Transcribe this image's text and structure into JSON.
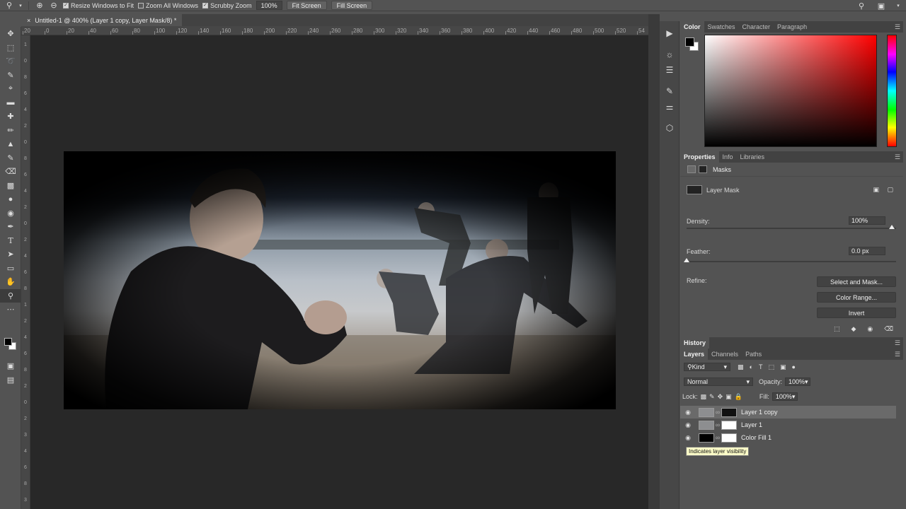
{
  "options_bar": {
    "resize_windows": "Resize Windows to Fit",
    "zoom_all": "Zoom All Windows",
    "scrubby": "Scrubby Zoom",
    "zoom_value": "100%",
    "fit_screen": "Fit Screen",
    "fill_screen": "Fill Screen"
  },
  "document": {
    "tab_title": "Untitled-1 @ 400% (Layer 1 copy, Layer Mask/8) *",
    "close": "×"
  },
  "rulers": {
    "top_labels": [
      "20",
      "0",
      "20",
      "40",
      "60",
      "80",
      "100",
      "120",
      "140",
      "160",
      "180",
      "200",
      "220",
      "240",
      "260",
      "280",
      "300",
      "320",
      "340",
      "360",
      "380",
      "400",
      "420",
      "440",
      "460",
      "480",
      "500",
      "520",
      "54"
    ],
    "left_labels": [
      "1",
      "0",
      "8",
      "6",
      "4",
      "2",
      "0",
      "8",
      "6",
      "4",
      "2",
      "0",
      "2",
      "4",
      "6",
      "8",
      "1",
      "2",
      "4",
      "6",
      "8",
      "2",
      "0",
      "2",
      "3",
      "4",
      "6",
      "8",
      "3"
    ]
  },
  "color_panel": {
    "tabs": [
      "Color",
      "Swatches",
      "Character",
      "Paragraph"
    ],
    "active_tab": "Color"
  },
  "properties_panel": {
    "tabs": [
      "Properties",
      "Info",
      "Libraries"
    ],
    "header": "Masks",
    "mask_label": "Layer Mask",
    "density_label": "Density:",
    "density_value": "100%",
    "density": 1.0,
    "feather_label": "Feather:",
    "feather_value": "0.0 px",
    "feather": 0.0,
    "refine_label": "Refine:",
    "select_and_mask": "Select and Mask...",
    "color_range": "Color Range...",
    "invert": "Invert"
  },
  "history_panel": {
    "tab": "History"
  },
  "layers_panel": {
    "tabs": [
      "Layers",
      "Channels",
      "Paths"
    ],
    "kind": "Kind",
    "blend_mode": "Normal",
    "opacity_label": "Opacity:",
    "opacity_value": "100%",
    "lock_label": "Lock:",
    "fill_label": "Fill:",
    "fill_value": "100%",
    "layers": [
      {
        "name": "Layer 1 copy",
        "selected": true,
        "mask": "black"
      },
      {
        "name": "Layer 1",
        "selected": false,
        "mask": "white"
      },
      {
        "name": "Color Fill 1",
        "selected": false,
        "mask": "white"
      }
    ],
    "tooltip": "Indicates layer visibility"
  },
  "colors": {
    "panel_bg": "#535353",
    "canvas_bg": "#282828",
    "selected_layer": "#6a6a6a"
  }
}
